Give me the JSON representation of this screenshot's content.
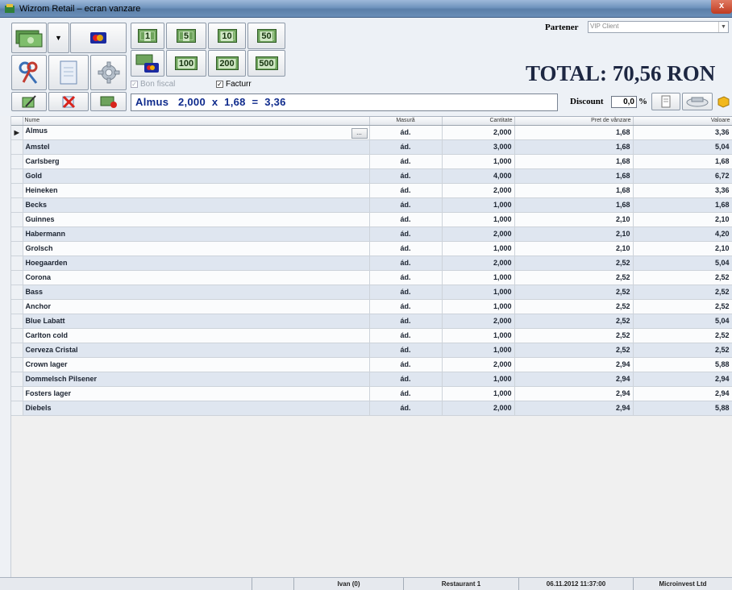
{
  "window": {
    "title": "Wizrom Retail – ecran vanzare",
    "close_label": "x"
  },
  "toolbar": {
    "banknotes": [
      "1",
      "5",
      "10",
      "50",
      "100",
      "200",
      "500"
    ],
    "checkboxes": {
      "bon_fiscal": {
        "label": "Bon fiscal",
        "checked": true,
        "enabled": false
      },
      "factura": {
        "label": "Facturr",
        "checked": true,
        "enabled": true
      }
    },
    "calc_line": "Almus   2,000  x  1,68  =  3,36",
    "partner_label": "Partener",
    "partner_value": "VIP Client",
    "total_text": "TOTAL:  70,56 RON",
    "discount_label": "Discount",
    "discount_value": "0,0",
    "discount_unit": "%"
  },
  "grid": {
    "columns": [
      "Nume",
      "Masură",
      "Cantitate",
      "Pret de vânzare",
      "Valoare"
    ],
    "rows": [
      {
        "name": "Almus",
        "unit": "ád.",
        "qty": "2,000",
        "price": "1,68",
        "value": "3,36"
      },
      {
        "name": "Amstel",
        "unit": "ád.",
        "qty": "3,000",
        "price": "1,68",
        "value": "5,04"
      },
      {
        "name": "Carlsberg",
        "unit": "ád.",
        "qty": "1,000",
        "price": "1,68",
        "value": "1,68"
      },
      {
        "name": "Gold",
        "unit": "ád.",
        "qty": "4,000",
        "price": "1,68",
        "value": "6,72"
      },
      {
        "name": "Heineken",
        "unit": "ád.",
        "qty": "2,000",
        "price": "1,68",
        "value": "3,36"
      },
      {
        "name": "Becks",
        "unit": "ád.",
        "qty": "1,000",
        "price": "1,68",
        "value": "1,68"
      },
      {
        "name": "Guinnes",
        "unit": "ád.",
        "qty": "1,000",
        "price": "2,10",
        "value": "2,10"
      },
      {
        "name": "Habermann",
        "unit": "ád.",
        "qty": "2,000",
        "price": "2,10",
        "value": "4,20"
      },
      {
        "name": "Grolsch",
        "unit": "ád.",
        "qty": "1,000",
        "price": "2,10",
        "value": "2,10"
      },
      {
        "name": "Hoegaarden",
        "unit": "ád.",
        "qty": "2,000",
        "price": "2,52",
        "value": "5,04"
      },
      {
        "name": "Corona",
        "unit": "ád.",
        "qty": "1,000",
        "price": "2,52",
        "value": "2,52"
      },
      {
        "name": "Bass",
        "unit": "ád.",
        "qty": "1,000",
        "price": "2,52",
        "value": "2,52"
      },
      {
        "name": "Anchor",
        "unit": "ád.",
        "qty": "1,000",
        "price": "2,52",
        "value": "2,52"
      },
      {
        "name": "Blue Labatt",
        "unit": "ád.",
        "qty": "2,000",
        "price": "2,52",
        "value": "5,04"
      },
      {
        "name": "Carlton cold",
        "unit": "ád.",
        "qty": "1,000",
        "price": "2,52",
        "value": "2,52"
      },
      {
        "name": "Cerveza Cristal",
        "unit": "ád.",
        "qty": "1,000",
        "price": "2,52",
        "value": "2,52"
      },
      {
        "name": "Crown lager",
        "unit": "ád.",
        "qty": "2,000",
        "price": "2,94",
        "value": "5,88"
      },
      {
        "name": "Dommelsch Pilsener",
        "unit": "ád.",
        "qty": "1,000",
        "price": "2,94",
        "value": "2,94"
      },
      {
        "name": "Fosters lager",
        "unit": "ád.",
        "qty": "1,000",
        "price": "2,94",
        "value": "2,94"
      },
      {
        "name": "Diebels",
        "unit": "ád.",
        "qty": "2,000",
        "price": "2,94",
        "value": "5,88"
      }
    ],
    "current_row_marker": "▶",
    "ellipsis_label": "..."
  },
  "statusbar": {
    "cells": [
      "",
      "",
      "Ivan (0)",
      "Restaurant 1",
      "06.11.2012 11:37:00",
      "Microinvest Ltd"
    ]
  },
  "icons": {
    "app": "app-icon",
    "cash": "cash-icon",
    "card": "card-icon",
    "keys": "keys-icon",
    "document": "document-icon",
    "settings": "gear-icon",
    "edit": "edit-icon",
    "delete": "delete-icon",
    "cash_card": "cash-card-icon"
  },
  "colors": {
    "accent_text": "#0e2a8c",
    "row_alt": "#dfe6f0",
    "total_text": "#1d2742"
  }
}
